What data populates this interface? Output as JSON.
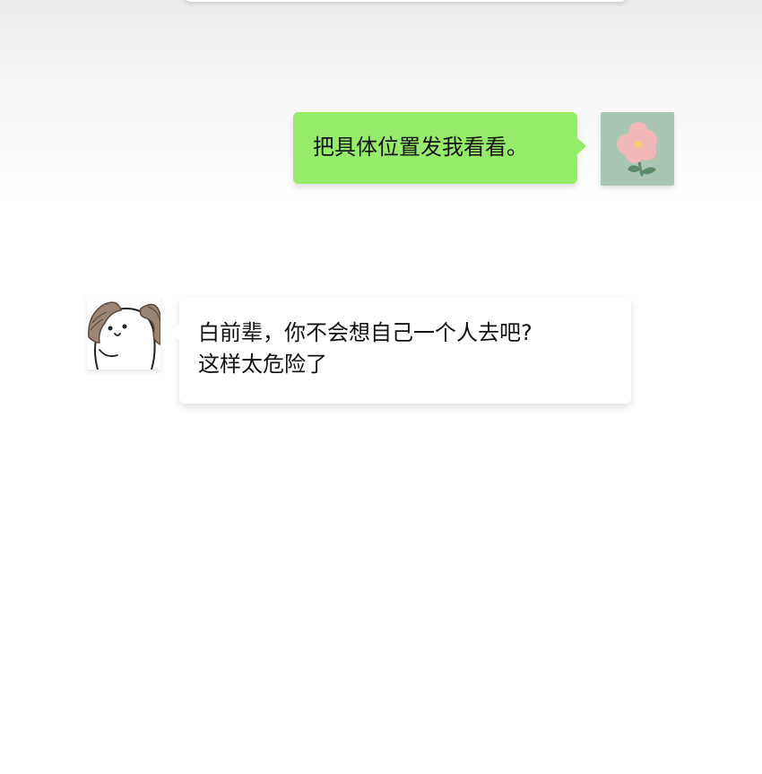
{
  "messages": [
    {
      "sender": "self",
      "avatar_icon": "flower-icon",
      "bubble_color": "#95ec69",
      "lines": [
        "把具体位置发我看看。"
      ]
    },
    {
      "sender": "other",
      "avatar_icon": "ram-icon",
      "bubble_color": "#ffffff",
      "lines": [
        "白前辈，你不会想自己一个人去吧?",
        "这样太危险了"
      ]
    }
  ]
}
